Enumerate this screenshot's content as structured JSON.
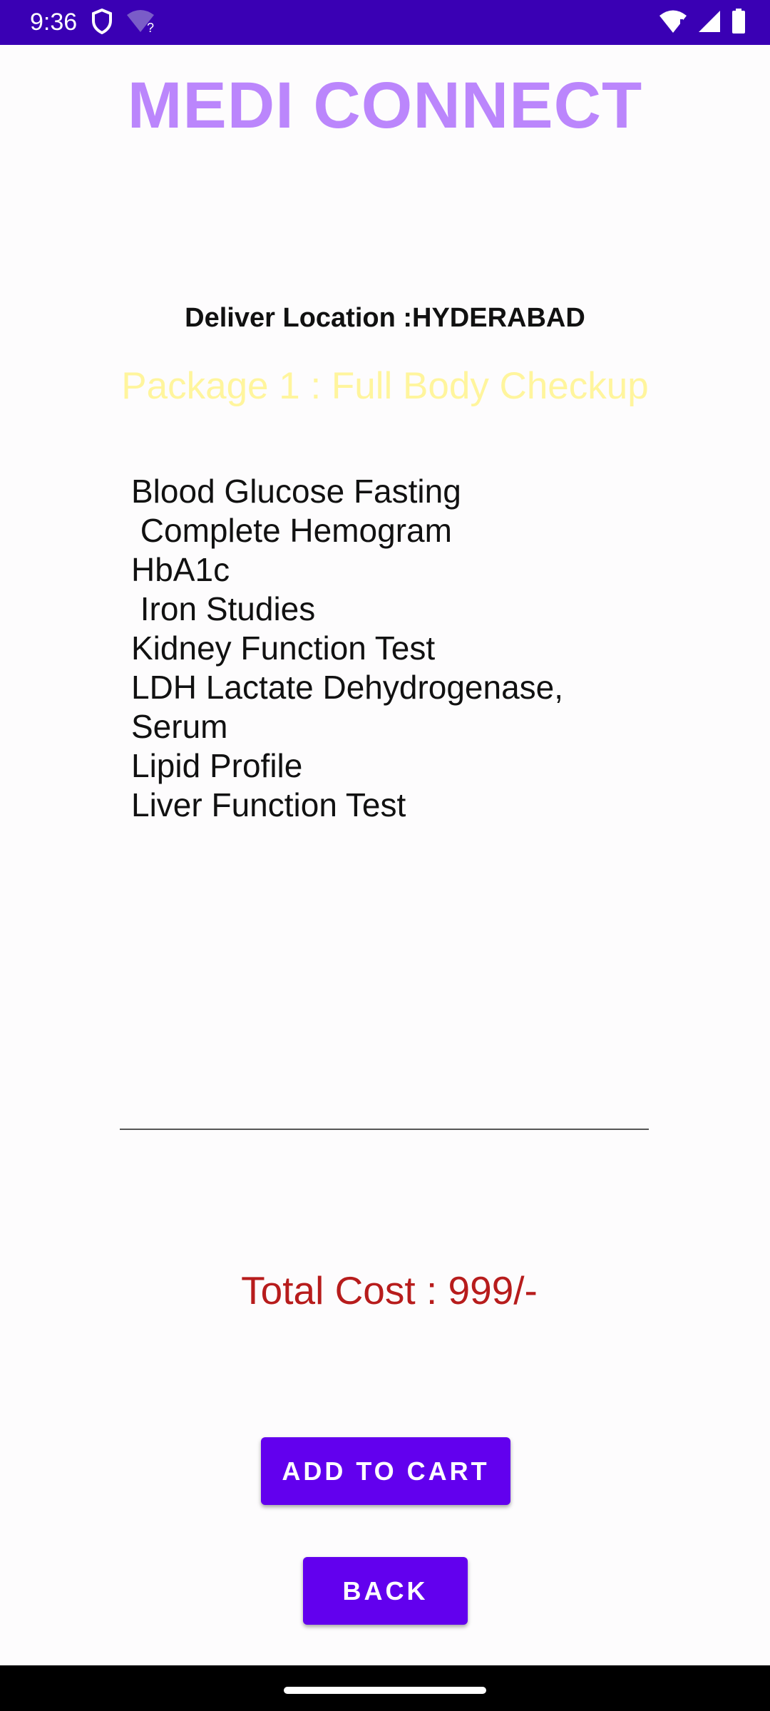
{
  "status_bar": {
    "time": "9:36",
    "left_icons": [
      "shield-icon",
      "wifi-question-icon"
    ],
    "right_icons": [
      "wifi-icon",
      "signal-icon",
      "battery-icon"
    ]
  },
  "app": {
    "title": "MEDI CONNECT"
  },
  "delivery": {
    "location_text": "Deliver Location :HYDERABAD"
  },
  "package": {
    "title": "Package 1 : Full Body Checkup",
    "tests_text": "Blood Glucose Fasting\n Complete Hemogram\nHbA1c\n Iron Studies\nKidney Function Test\nLDH Lactate Dehydrogenase,\nSerum\nLipid Profile\nLiver Function Test"
  },
  "cost": {
    "total_text": "Total Cost : 999/-"
  },
  "buttons": {
    "add_to_cart": "ADD TO CART",
    "back": "BACK"
  },
  "colors": {
    "status_bar": "#3a00b4",
    "title": "#bb86fc",
    "package_title": "#fff59d",
    "total_cost": "#b71c1c",
    "button": "#6200ee"
  }
}
